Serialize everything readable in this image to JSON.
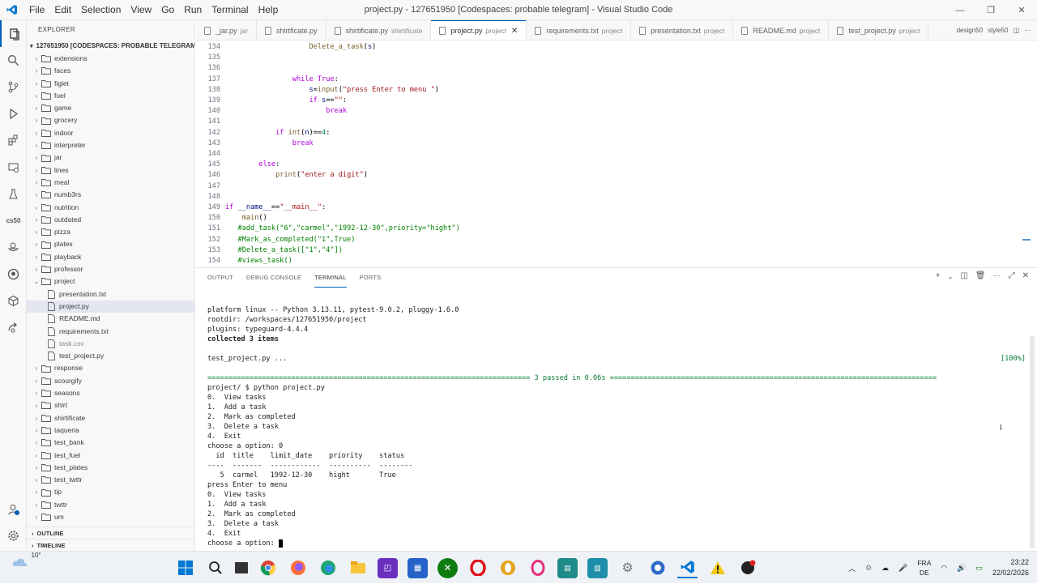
{
  "window": {
    "title": "project.py - 127651950 [Codespaces: probable telegram] - Visual Studio Code",
    "menu": [
      "File",
      "Edit",
      "Selection",
      "View",
      "Go",
      "Run",
      "Terminal",
      "Help"
    ]
  },
  "sidebar": {
    "header": "EXPLORER",
    "root": "127651950 [CODESPACES: PROBABLE TELEGRAM]",
    "items": [
      {
        "label": "extensions",
        "kind": "folder"
      },
      {
        "label": "faces",
        "kind": "folder"
      },
      {
        "label": "figlet",
        "kind": "folder"
      },
      {
        "label": "fuel",
        "kind": "folder"
      },
      {
        "label": "game",
        "kind": "folder"
      },
      {
        "label": "grocery",
        "kind": "folder"
      },
      {
        "label": "indoor",
        "kind": "folder"
      },
      {
        "label": "interpreter",
        "kind": "folder"
      },
      {
        "label": "jar",
        "kind": "folder"
      },
      {
        "label": "lines",
        "kind": "folder"
      },
      {
        "label": "meal",
        "kind": "folder"
      },
      {
        "label": "numb3rs",
        "kind": "folder"
      },
      {
        "label": "nutrition",
        "kind": "folder"
      },
      {
        "label": "outdated",
        "kind": "folder"
      },
      {
        "label": "pizza",
        "kind": "folder"
      },
      {
        "label": "plates",
        "kind": "folder"
      },
      {
        "label": "playback",
        "kind": "folder"
      },
      {
        "label": "professor",
        "kind": "folder"
      },
      {
        "label": "project",
        "kind": "folder-open"
      },
      {
        "label": "presentation.txt",
        "kind": "file"
      },
      {
        "label": "project.py",
        "kind": "file-selected"
      },
      {
        "label": "README.md",
        "kind": "file"
      },
      {
        "label": "requirements.txt",
        "kind": "file"
      },
      {
        "label": "task.csv",
        "kind": "file-dim"
      },
      {
        "label": "test_project.py",
        "kind": "file"
      },
      {
        "label": "response",
        "kind": "folder"
      },
      {
        "label": "scourgify",
        "kind": "folder"
      },
      {
        "label": "seasons",
        "kind": "folder"
      },
      {
        "label": "shirt",
        "kind": "folder"
      },
      {
        "label": "shirtificate",
        "kind": "folder"
      },
      {
        "label": "taqueria",
        "kind": "folder"
      },
      {
        "label": "test_bank",
        "kind": "folder"
      },
      {
        "label": "test_fuel",
        "kind": "folder"
      },
      {
        "label": "test_plates",
        "kind": "folder"
      },
      {
        "label": "test_twttr",
        "kind": "folder"
      },
      {
        "label": "tip",
        "kind": "folder"
      },
      {
        "label": "twttr",
        "kind": "folder"
      },
      {
        "label": "um",
        "kind": "folder"
      }
    ],
    "outline": "OUTLINE",
    "timeline": "TIMELINE"
  },
  "tabs": [
    {
      "name": "_jar.py",
      "desc": "jar"
    },
    {
      "name": "shirtficate.py",
      "desc": ""
    },
    {
      "name": "shirtificate.py",
      "desc": "shirtificate"
    },
    {
      "name": "project.py",
      "desc": "project",
      "active": true
    },
    {
      "name": "requirements.txt",
      "desc": "project"
    },
    {
      "name": "presentation.txt",
      "desc": "project"
    },
    {
      "name": "README.md",
      "desc": "project"
    },
    {
      "name": "test_project.py",
      "desc": "project"
    }
  ],
  "tab_extras": [
    "design50",
    "style50"
  ],
  "code": [
    {
      "n": "134",
      "indent": "                    ",
      "parts": [
        {
          "t": "Delete_a_task",
          "c": "fn"
        },
        {
          "t": "(",
          "c": "plain"
        },
        {
          "t": "s",
          "c": "var"
        },
        {
          "t": ")",
          "c": "plain"
        }
      ]
    },
    {
      "n": "135",
      "indent": "",
      "parts": []
    },
    {
      "n": "136",
      "indent": "",
      "parts": []
    },
    {
      "n": "137",
      "indent": "                ",
      "parts": [
        {
          "t": "while",
          "c": "kw"
        },
        {
          "t": " ",
          "c": "plain"
        },
        {
          "t": "True",
          "c": "kw"
        },
        {
          "t": ":",
          "c": "plain"
        }
      ]
    },
    {
      "n": "138",
      "indent": "                    ",
      "parts": [
        {
          "t": "s",
          "c": "var"
        },
        {
          "t": "=",
          "c": "plain"
        },
        {
          "t": "input",
          "c": "fn"
        },
        {
          "t": "(",
          "c": "plain"
        },
        {
          "t": "\"press Enter to menu \"",
          "c": "str"
        },
        {
          "t": ")",
          "c": "plain"
        }
      ]
    },
    {
      "n": "139",
      "indent": "                    ",
      "parts": [
        {
          "t": "if",
          "c": "kw"
        },
        {
          "t": " ",
          "c": "plain"
        },
        {
          "t": "s",
          "c": "var"
        },
        {
          "t": "==",
          "c": "plain"
        },
        {
          "t": "\"\"",
          "c": "str"
        },
        {
          "t": ":",
          "c": "plain"
        }
      ]
    },
    {
      "n": "140",
      "indent": "                        ",
      "parts": [
        {
          "t": "break",
          "c": "kw"
        }
      ]
    },
    {
      "n": "141",
      "indent": "",
      "parts": []
    },
    {
      "n": "142",
      "indent": "            ",
      "parts": [
        {
          "t": "if",
          "c": "kw"
        },
        {
          "t": " ",
          "c": "plain"
        },
        {
          "t": "int",
          "c": "fn"
        },
        {
          "t": "(",
          "c": "plain"
        },
        {
          "t": "n",
          "c": "var"
        },
        {
          "t": ")==",
          "c": "plain"
        },
        {
          "t": "4",
          "c": "num"
        },
        {
          "t": ":",
          "c": "plain"
        }
      ]
    },
    {
      "n": "143",
      "indent": "                ",
      "parts": [
        {
          "t": "break",
          "c": "kw"
        }
      ]
    },
    {
      "n": "144",
      "indent": "",
      "parts": []
    },
    {
      "n": "145",
      "indent": "        ",
      "parts": [
        {
          "t": "else",
          "c": "kw"
        },
        {
          "t": ":",
          "c": "plain"
        }
      ]
    },
    {
      "n": "146",
      "indent": "            ",
      "parts": [
        {
          "t": "print",
          "c": "fn"
        },
        {
          "t": "(",
          "c": "plain"
        },
        {
          "t": "\"enter a digit\"",
          "c": "str"
        },
        {
          "t": ")",
          "c": "plain"
        }
      ]
    },
    {
      "n": "147",
      "indent": "",
      "parts": []
    },
    {
      "n": "148",
      "indent": "",
      "parts": []
    },
    {
      "n": "149",
      "indent": "",
      "parts": [
        {
          "t": "if",
          "c": "kw"
        },
        {
          "t": " ",
          "c": "plain"
        },
        {
          "t": "__name__",
          "c": "var"
        },
        {
          "t": "==",
          "c": "plain"
        },
        {
          "t": "\"__main__\"",
          "c": "str"
        },
        {
          "t": ":",
          "c": "plain"
        }
      ]
    },
    {
      "n": "150",
      "indent": "    ",
      "parts": [
        {
          "t": "main",
          "c": "fn"
        },
        {
          "t": "()",
          "c": "plain"
        }
      ]
    },
    {
      "n": "151",
      "indent": "   ",
      "parts": [
        {
          "t": "#add_task(\"6\",\"carmel\",\"1992-12-30\",priority=\"hight\")",
          "c": "cm"
        }
      ]
    },
    {
      "n": "152",
      "indent": "   ",
      "parts": [
        {
          "t": "#Mark_as_completed(\"1\",True)",
          "c": "cm"
        }
      ]
    },
    {
      "n": "153",
      "indent": "   ",
      "parts": [
        {
          "t": "#Delete_a_task([\"1\",\"4\"])",
          "c": "cm"
        }
      ]
    },
    {
      "n": "154",
      "indent": "   ",
      "parts": [
        {
          "t": "#views_task()",
          "c": "cm"
        }
      ]
    }
  ],
  "panel": {
    "tabs": [
      "OUTPUT",
      "DEBUG CONSOLE",
      "TERMINAL",
      "PORTS"
    ],
    "active_tab": "TERMINAL"
  },
  "terminal": {
    "lines": [
      {
        "t": "platform linux -- Python 3.13.11, pytest-9.0.2, pluggy-1.6.0",
        "s": ""
      },
      {
        "t": "rootdir: /workspaces/127651950/project",
        "s": ""
      },
      {
        "t": "plugins: typeguard-4.4.4",
        "s": ""
      },
      {
        "t": "collected 3 items",
        "s": "bold"
      },
      {
        "t": "",
        "s": ""
      },
      {
        "t": "test_project.py ...",
        "s": "",
        "right": "[100%]"
      },
      {
        "t": "",
        "s": ""
      },
      {
        "t": "============================================================================= 3 passed in 0.06s ==============================================================================",
        "s": "green"
      },
      {
        "t": "project/ $ python project.py",
        "s": ""
      },
      {
        "t": "0.  View tasks",
        "s": ""
      },
      {
        "t": "1.  Add a task",
        "s": ""
      },
      {
        "t": "2.  Mark as completed",
        "s": ""
      },
      {
        "t": "3.  Delete a task",
        "s": ""
      },
      {
        "t": "4.  Exit",
        "s": ""
      },
      {
        "t": "choose a option: 0",
        "s": ""
      },
      {
        "t": "  id  title    limit_date    priority    status",
        "s": ""
      },
      {
        "t": "----  -------  ------------  ----------  --------",
        "s": ""
      },
      {
        "t": "   5  carmel   1992-12-30    hight       True",
        "s": ""
      },
      {
        "t": "press Enter to menu",
        "s": ""
      },
      {
        "t": "0.  View tasks",
        "s": ""
      },
      {
        "t": "1.  Add a task",
        "s": ""
      },
      {
        "t": "2.  Mark as completed",
        "s": ""
      },
      {
        "t": "3.  Delete a task",
        "s": ""
      },
      {
        "t": "4.  Exit",
        "s": ""
      },
      {
        "t": "choose a option: ",
        "s": "",
        "cursor": true
      }
    ]
  },
  "taskbar": {
    "weather": "10°",
    "lang_top": "FRA",
    "lang_bottom": "DE",
    "time": "23:22",
    "date": "22/02/2026"
  },
  "colors": {
    "accent": "#005fb8",
    "pass_green": "#0a7b35"
  }
}
